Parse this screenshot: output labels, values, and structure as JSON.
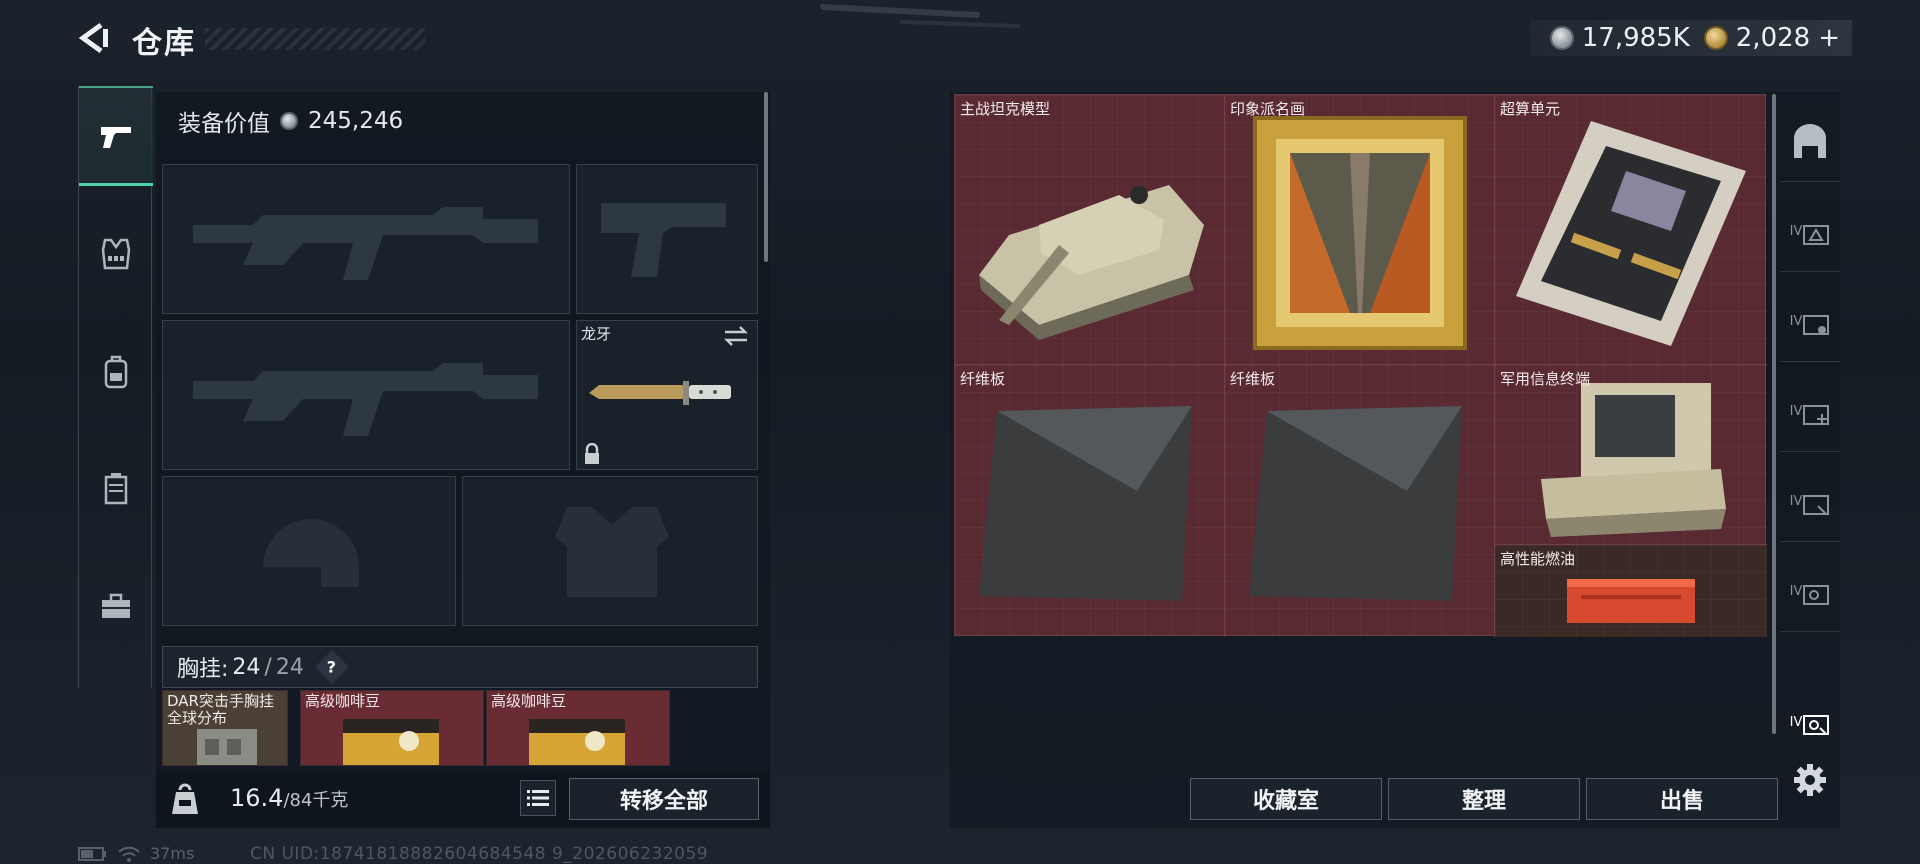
{
  "header": {
    "title": "仓库",
    "currency_silver": "17,985K",
    "currency_gold": "2,028",
    "gold_add": "+"
  },
  "left": {
    "equip_value_label": "装备价值",
    "equip_value": "245,246",
    "tabs": [
      "gun-icon",
      "vest-icon",
      "backpack-icon",
      "pouch-icon",
      "toolbox-icon"
    ],
    "knife_label": "龙牙",
    "rig_label": "胸挂:",
    "rig_used": "24",
    "rig_sep": "/",
    "rig_total": "24",
    "rig_help": "?",
    "rig_items": [
      {
        "label": "DAR突击手胸挂全球分布"
      },
      {
        "label": "高级咖啡豆"
      },
      {
        "label": "高级咖啡豆"
      }
    ],
    "weight_current": "16.4",
    "weight_cap": "/84千克",
    "transfer_all": "转移全部"
  },
  "stash": {
    "items": [
      {
        "label": "主战坦克模型"
      },
      {
        "label": "印象派名画"
      },
      {
        "label": "超算单元"
      },
      {
        "label": "纤维板"
      },
      {
        "label": "纤维板"
      },
      {
        "label": "军用信息终端"
      },
      {
        "label": "高性能燃油"
      }
    ],
    "right_tabs": [
      "IV",
      "IV",
      "IV",
      "IV",
      "IV",
      "IV"
    ]
  },
  "actions": {
    "collection": "收藏室",
    "organize": "整理",
    "sell": "出售"
  },
  "status": {
    "ping": "37ms",
    "uid": "CN UID:18741818882604684548 9_202606232059"
  }
}
